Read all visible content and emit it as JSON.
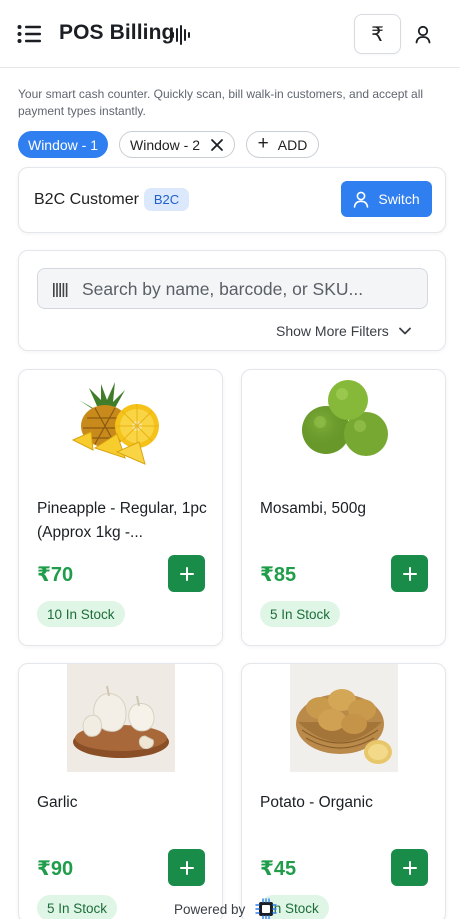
{
  "header": {
    "title": "POS Billing",
    "currency_button_symbol": "₹",
    "icons": [
      "menu-icon",
      "audio-wave-icon",
      "rupee-icon",
      "user-icon"
    ]
  },
  "tagline": "Your smart cash counter. Quickly scan, bill walk-in customers, and accept all payment types instantly.",
  "windows": {
    "tabs": [
      {
        "label": "Window - 1",
        "active": true
      },
      {
        "label": "Window - 2",
        "active": false,
        "closable": true
      }
    ],
    "add_label": "ADD"
  },
  "customer": {
    "name": "B2C Customer",
    "badge": "B2C",
    "switch_label": "Switch"
  },
  "search": {
    "placeholder": "Search by name, barcode, or SKU...",
    "filters_label": "Show More Filters"
  },
  "products": [
    {
      "name": "Pineapple - Regular, 1pc (Approx 1kg -...",
      "price": "₹70",
      "stock": "10 In Stock"
    },
    {
      "name": "Mosambi, 500g",
      "price": "₹85",
      "stock": "5 In Stock"
    },
    {
      "name": "Garlic",
      "price": "₹90",
      "stock": "5 In Stock"
    },
    {
      "name": "Potato - Organic",
      "price": "₹45",
      "stock": "In Stock"
    }
  ],
  "footer": {
    "label": "Powered by"
  },
  "colors": {
    "primary": "#2f7ff0",
    "price_green": "#1f9d4a",
    "add_button": "#1a8c4a",
    "stock_badge_bg": "#dff5e5"
  }
}
